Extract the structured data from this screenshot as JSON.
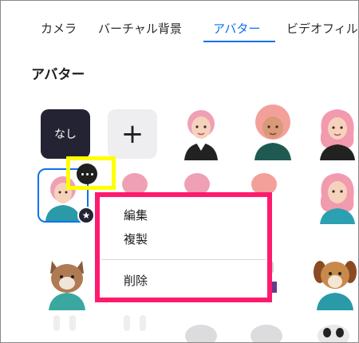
{
  "tabs": [
    {
      "label": "カメラ",
      "active": false
    },
    {
      "label": "バーチャル背景",
      "active": false
    },
    {
      "label": "アバター",
      "active": true
    },
    {
      "label": "ビデオフィルター",
      "active": false
    }
  ],
  "section_title": "アバター",
  "tiles": {
    "none_label": "なし",
    "add_label": "+"
  },
  "context_menu": {
    "items": [
      {
        "label": "編集"
      },
      {
        "label": "複製"
      },
      {
        "label": "削除"
      }
    ]
  },
  "colors": {
    "accent": "#0e72ed",
    "highlight_yellow": "#ffff00",
    "highlight_pink": "#ff1a6e",
    "dark_tile": "#232333"
  }
}
